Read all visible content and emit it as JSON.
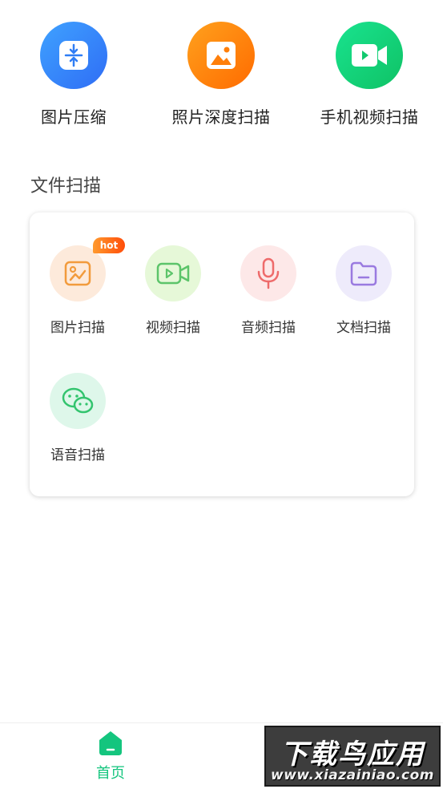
{
  "top_tools": [
    {
      "label": "图片压缩",
      "icon": "compress-icon",
      "color": "#2f6df5"
    },
    {
      "label": "照片深度扫描",
      "icon": "photo-icon",
      "color": "#ff7a00"
    },
    {
      "label": "手机视频扫描",
      "icon": "video-camera-icon",
      "color": "#12c96e"
    }
  ],
  "section": {
    "title": "文件扫描"
  },
  "file_scan": {
    "items": [
      {
        "label": "图片扫描",
        "icon": "image-icon",
        "color": "#f29b3c",
        "badge": "hot"
      },
      {
        "label": "视频扫描",
        "icon": "video-icon",
        "color": "#5cc46a"
      },
      {
        "label": "音频扫描",
        "icon": "microphone-icon",
        "color": "#ee6b6b"
      },
      {
        "label": "文档扫描",
        "icon": "folder-icon",
        "color": "#9a7ae0"
      },
      {
        "label": "语音扫描",
        "icon": "wechat-voice-icon",
        "color": "#33c46e"
      }
    ]
  },
  "bottom_nav": {
    "home": {
      "label": "首页",
      "icon": "home-icon",
      "color": "#14c57e"
    }
  },
  "watermark": {
    "line1": "下载鸟应用",
    "line2": "www.xiazainiao.com"
  }
}
